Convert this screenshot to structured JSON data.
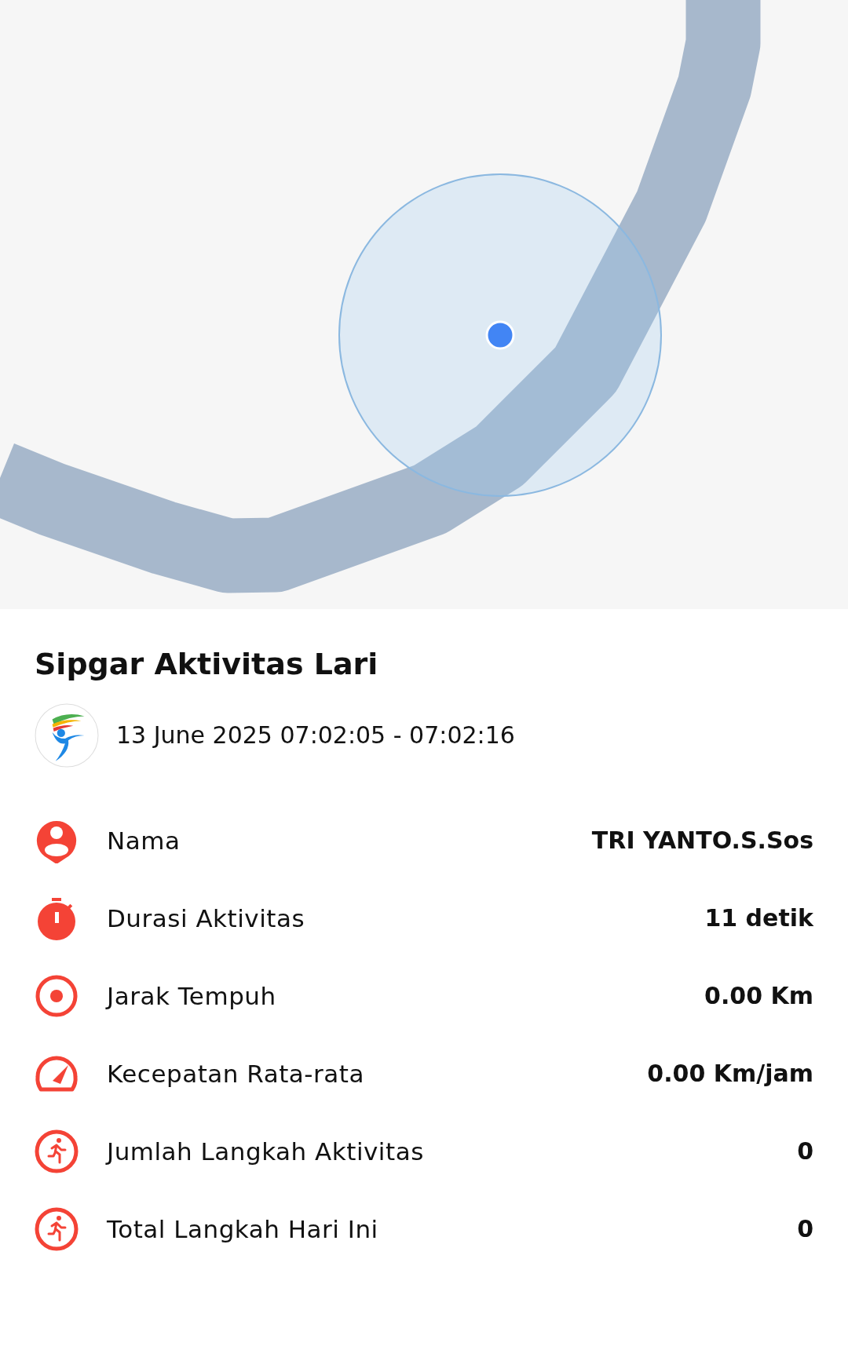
{
  "map": {
    "kind": "map"
  },
  "title": "Sipgar Aktivitas Lari",
  "session": {
    "datetime": "13 June 2025 07:02:05 - 07:02:16"
  },
  "stats": [
    {
      "kind": "person",
      "label": "Nama",
      "value": "TRI YANTO.S.Sos"
    },
    {
      "kind": "stopwatch",
      "label": "Durasi Aktivitas",
      "value": "11 detik"
    },
    {
      "kind": "target",
      "label": "Jarak Tempuh",
      "value": "0.00 Km"
    },
    {
      "kind": "speedometer",
      "label": "Kecepatan Rata-rata",
      "value": "0.00 Km/jam"
    },
    {
      "kind": "runner",
      "label": "Jumlah Langkah Aktivitas",
      "value": "0"
    },
    {
      "kind": "runner",
      "label": "Total Langkah Hari Ini",
      "value": "0"
    }
  ]
}
